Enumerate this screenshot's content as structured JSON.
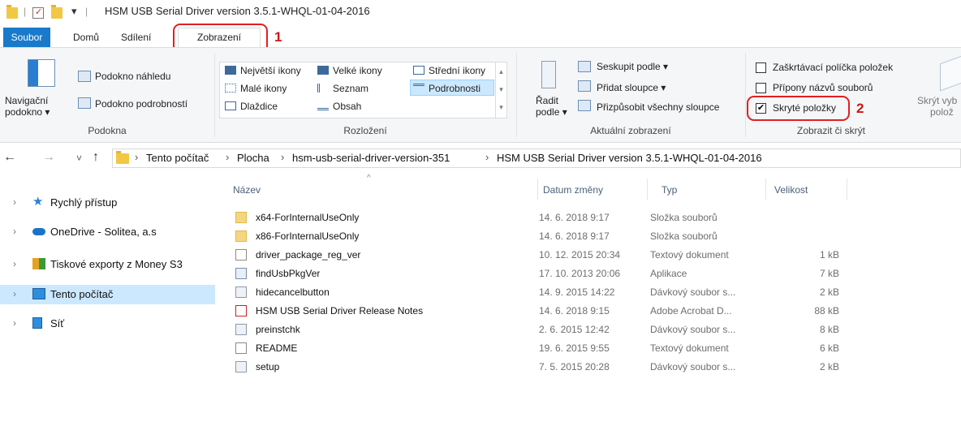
{
  "window": {
    "title": "HSM USB Serial Driver version 3.5.1-WHQL-01-04-2016",
    "quick_access_sep": "|",
    "dropdown_glyph": "▾"
  },
  "tabs": [
    "Soubor",
    "Domů",
    "Sdílení",
    "Zobrazení"
  ],
  "annotations": {
    "one": "1",
    "two": "2"
  },
  "ribbon": {
    "panes": {
      "navigation_pane": "Navigační",
      "navigation_pane2": "podokno ▾",
      "preview_pane": "Podokno náhledu",
      "details_pane": "Podokno podrobností",
      "label": "Podokna"
    },
    "layout": {
      "items": [
        "Největší ikony",
        "Velké ikony",
        "Střední ikony",
        "Malé ikony",
        "Seznam",
        "Podrobnosti",
        "Dlaždice",
        "Obsah"
      ],
      "selected": "Podrobnosti",
      "label": "Rozložení"
    },
    "current_view": {
      "sort_by": "Řadit",
      "sort_by2": "podle ▾",
      "group_by": "Seskupit podle ▾",
      "add_columns": "Přidat sloupce ▾",
      "fit_columns": "Přizpůsobit všechny sloupce",
      "label": "Aktuální zobrazení"
    },
    "show_hide": {
      "item_checkboxes": "Zaškrtávací políčka položek",
      "file_extensions": "Přípony názvů souborů",
      "hidden_items": "Skryté položky",
      "hidden_checked": "✔",
      "label": "Zobrazit či skrýt",
      "hide_selected": "Skrýt vyb",
      "hide_selected2": "polož"
    }
  },
  "address": {
    "back": "←",
    "forward": "→",
    "recent": "˅",
    "up": "↑",
    "sep": "›",
    "crumbs": [
      "Tento počítač",
      "Plocha",
      "hsm-usb-serial-driver-version-351",
      "HSM USB Serial Driver version 3.5.1-WHQL-01-04-2016"
    ]
  },
  "nav": {
    "chevron": "›",
    "items": [
      "Rychlý přístup",
      "OneDrive - Solitea, a.s",
      "Tiskové exporty z Money S3",
      "Tento počítač",
      "Síť"
    ]
  },
  "columns": {
    "name": "Název",
    "date": "Datum změny",
    "type": "Typ",
    "size": "Velikost",
    "sort_glyph": "^"
  },
  "files": [
    {
      "name": "x64-ForInternalUseOnly",
      "date": "14. 6. 2018 9:17",
      "type": "Složka souborů",
      "size": ""
    },
    {
      "name": "x86-ForInternalUseOnly",
      "date": "14. 6. 2018 9:17",
      "type": "Složka souborů",
      "size": ""
    },
    {
      "name": "driver_package_reg_ver",
      "date": "10. 12. 2015 20:34",
      "type": "Textový dokument",
      "size": "1 kB"
    },
    {
      "name": "findUsbPkgVer",
      "date": "17. 10. 2013 20:06",
      "type": "Aplikace",
      "size": "7 kB"
    },
    {
      "name": "hidecancelbutton",
      "date": "14. 9. 2015 14:22",
      "type": "Dávkový soubor s...",
      "size": "2 kB"
    },
    {
      "name": "HSM USB Serial Driver Release Notes",
      "date": "14. 6. 2018 9:15",
      "type": "Adobe Acrobat D...",
      "size": "88 kB"
    },
    {
      "name": "preinstchk",
      "date": "2. 6. 2015 12:42",
      "type": "Dávkový soubor s...",
      "size": "8 kB"
    },
    {
      "name": "README",
      "date": "19. 6. 2015 9:55",
      "type": "Textový dokument",
      "size": "6 kB"
    },
    {
      "name": "setup",
      "date": "7. 5. 2015 20:28",
      "type": "Dávkový soubor s...",
      "size": "2 kB"
    }
  ],
  "colors": {
    "accent": "#1979ca",
    "annotation": "#e02020",
    "selection": "#cce8ff"
  }
}
